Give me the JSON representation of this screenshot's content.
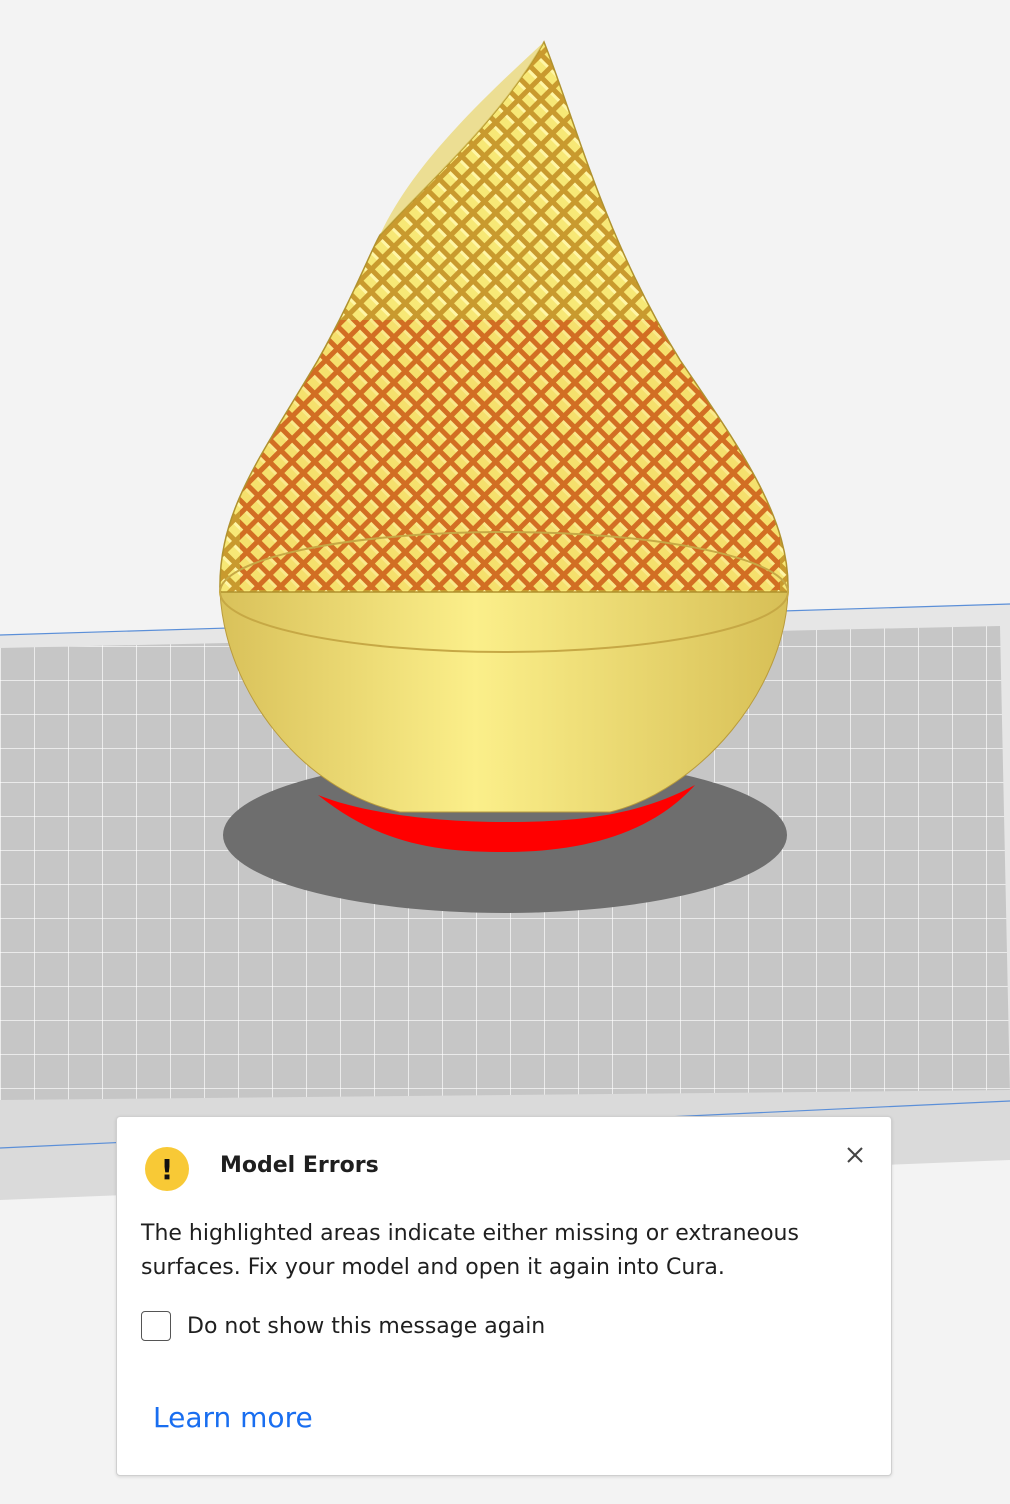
{
  "scene": {
    "model_color": "#f5e66a",
    "error_highlight_color": "#ff0000",
    "build_plate_color": "#c8c8c8",
    "background_color": "#f3f3f3"
  },
  "toast": {
    "icon": "warning-exclamation-icon",
    "icon_glyph": "!",
    "title": "Model Errors",
    "body": "The highlighted areas indicate either missing or extraneous surfaces. Fix your model and open it again into Cura.",
    "checkbox_label": "Do not show this message again",
    "checkbox_checked": false,
    "learn_more": "Learn more",
    "close_icon": "close-icon",
    "accent_color": "#196ef0",
    "warning_color": "#f8c936"
  }
}
